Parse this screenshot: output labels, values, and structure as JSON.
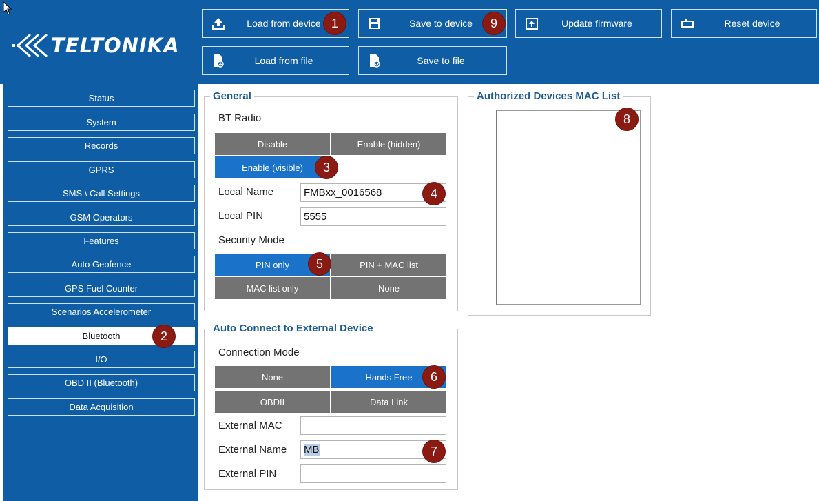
{
  "brand": {
    "logo_text": "TELTONIKA"
  },
  "toolbar": {
    "load_from_device": "Load from device",
    "save_to_device": "Save to device",
    "update_firmware": "Update firmware",
    "reset_device": "Reset device",
    "load_from_file": "Load from file",
    "save_to_file": "Save to file"
  },
  "sidebar": {
    "items": [
      {
        "label": "Status"
      },
      {
        "label": "System"
      },
      {
        "label": "Records"
      },
      {
        "label": "GPRS"
      },
      {
        "label": "SMS \\ Call Settings"
      },
      {
        "label": "GSM Operators"
      },
      {
        "label": "Features"
      },
      {
        "label": "Auto Geofence"
      },
      {
        "label": "GPS Fuel Counter"
      },
      {
        "label": "Scenarios Accelerometer"
      },
      {
        "label": "Bluetooth"
      },
      {
        "label": "I/O"
      },
      {
        "label": "OBD II (Bluetooth)"
      },
      {
        "label": "Data Acquisition"
      }
    ]
  },
  "general": {
    "title": "General",
    "bt_radio_label": "BT Radio",
    "bt_radio_options": [
      "Disable",
      "Enable (hidden)",
      "Enable (visible)"
    ],
    "bt_radio_selected": "Enable (visible)",
    "local_name_label": "Local Name",
    "local_name_value": "FMBxx_0016568",
    "local_pin_label": "Local PIN",
    "local_pin_value": "5555",
    "security_mode_label": "Security Mode",
    "security_options": [
      "PIN only",
      "PIN + MAC list",
      "MAC list only",
      "None"
    ],
    "security_selected": "PIN only"
  },
  "auto_connect": {
    "title": "Auto Connect to External Device",
    "connection_mode_label": "Connection Mode",
    "connection_options": [
      "None",
      "Hands Free",
      "OBDII",
      "Data Link"
    ],
    "connection_selected": "Hands Free",
    "external_mac_label": "External MAC",
    "external_mac_value": "",
    "external_name_label": "External Name",
    "external_name_value": "MB",
    "external_pin_label": "External PIN",
    "external_pin_value": ""
  },
  "mac_list": {
    "title": "Authorized Devices MAC List"
  },
  "badges": {
    "b1": "1",
    "b2": "2",
    "b3": "3",
    "b4": "4",
    "b5": "5",
    "b6": "6",
    "b7": "7",
    "b8": "8",
    "b9": "9"
  },
  "colors": {
    "brand_blue": "#0f5ea5",
    "selected_blue": "#1a73c9",
    "segment_gray": "#737373",
    "badge_red": "#8b1a12"
  },
  "icons": {
    "load_from_device": "upload-icon",
    "save_to_device": "floppy-disk-icon",
    "update_firmware": "firmware-upload-icon",
    "reset_device": "reset-icon",
    "load_from_file": "file-load-icon",
    "save_to_file": "file-save-icon"
  }
}
